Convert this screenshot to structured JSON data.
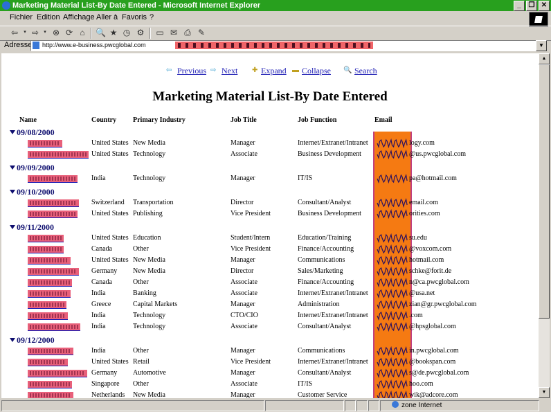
{
  "window": {
    "title": "Marketing Material List-By Date Entered - Microsoft Internet Explorer"
  },
  "menu": [
    {
      "label": "Fichier"
    },
    {
      "label": "Edition"
    },
    {
      "label": "Affichage"
    },
    {
      "label": "Aller à"
    },
    {
      "label": "Favoris"
    },
    {
      "label": "?"
    }
  ],
  "address": {
    "label": "Adresse",
    "url": "http://www.e-business.pwcglobal.com"
  },
  "nav": {
    "previous": "Previous",
    "next": "Next",
    "expand": "Expand",
    "collapse": "Collapse",
    "search": "Search"
  },
  "page": {
    "title": "Marketing Material List-By Date Entered"
  },
  "columns": {
    "name": "Name",
    "country": "Country",
    "industry": "Primary Industry",
    "title": "Job Title",
    "function": "Job Function",
    "email": "Email"
  },
  "groups": [
    {
      "date": "09/08/2000",
      "rows": [
        {
          "name_visible": "",
          "country": "United States",
          "industry": "New Media",
          "title": "Manager",
          "function": "Internet/Extranet/Intranet",
          "email_visible": "logy.com"
        },
        {
          "name_visible": "",
          "country": "United States",
          "industry": "Technology",
          "title": "Associate",
          "function": "Business Development",
          "email_visible": "@us.pwcglobal.com"
        }
      ]
    },
    {
      "date": "09/09/2000",
      "rows": [
        {
          "name_visible": "",
          "country": "India",
          "industry": "Technology",
          "title": "Manager",
          "function": "IT/IS",
          "email_visible": "pa@hotmail.com"
        }
      ]
    },
    {
      "date": "09/10/2000",
      "rows": [
        {
          "name_visible": "",
          "country": "Switzerland",
          "industry": "Transportation",
          "title": "Director",
          "function": "Consultant/Analyst",
          "email_visible": "email.com"
        },
        {
          "name_visible": "",
          "country": "United States",
          "industry": "Publishing",
          "title": "Vice President",
          "function": "Business Development",
          "email_visible": "orities.com"
        }
      ]
    },
    {
      "date": "09/11/2000",
      "rows": [
        {
          "name_visible": "",
          "country": "United States",
          "industry": "Education",
          "title": "Student/Intern",
          "function": "Education/Training",
          "email_visible": "su.edu"
        },
        {
          "name_visible": "",
          "country": "Canada",
          "industry": "Other",
          "title": "Vice President",
          "function": "Finance/Accounting",
          "email_visible": "@voxcom.com"
        },
        {
          "name_visible": "",
          "country": "United States",
          "industry": "New Media",
          "title": "Manager",
          "function": "Communications",
          "email_visible": "hotmail.com"
        },
        {
          "name_visible": "",
          "country": "Germany",
          "industry": "New Media",
          "title": "Director",
          "function": "Sales/Marketing",
          "email_visible": "schke@forit.de"
        },
        {
          "name_visible": "",
          "country": "Canada",
          "industry": "Other",
          "title": "Associate",
          "function": "Finance/Accounting",
          "email_visible": "n@ca.pwcglobal.com"
        },
        {
          "name_visible": "",
          "country": "India",
          "industry": "Banking",
          "title": "Associate",
          "function": "Internet/Extranet/Intranet",
          "email_visible": "@usa.net"
        },
        {
          "name_visible": "",
          "country": "Greece",
          "industry": "Capital Markets",
          "title": "Manager",
          "function": "Administration",
          "email_visible": "zian@gr.pwcglobal.com"
        },
        {
          "name_visible": "",
          "country": "India",
          "industry": "Technology",
          "title": "CTO/CIO",
          "function": "Internet/Extranet/Intranet",
          "email_visible": ".com"
        },
        {
          "name_visible": "",
          "country": "India",
          "industry": "Technology",
          "title": "Associate",
          "function": "Consultant/Analyst",
          "email_visible": "@hpsglobal.com"
        }
      ]
    },
    {
      "date": "09/12/2000",
      "rows": [
        {
          "name_visible": "",
          "country": "India",
          "industry": "Other",
          "title": "Manager",
          "function": "Communications",
          "email_visible": "in.pwcglobal.com"
        },
        {
          "name_visible": "",
          "country": "United States",
          "industry": "Retail",
          "title": "Vice President",
          "function": "Internet/Extranet/Intranet",
          "email_visible": "@bookspan.com"
        },
        {
          "name_visible": "",
          "country": "Germany",
          "industry": "Automotive",
          "title": "Manager",
          "function": "Consultant/Analyst",
          "email_visible": "s@de.pwcglobal.com"
        },
        {
          "name_visible": "",
          "country": "Singapore",
          "industry": "Other",
          "title": "Associate",
          "function": "IT/IS",
          "email_visible": "hoo.com"
        },
        {
          "name_visible": "",
          "country": "Netherlands",
          "industry": "New Media",
          "title": "Manager",
          "function": "Customer Service",
          "email_visible": "wik@adcore.com"
        }
      ]
    }
  ],
  "status": {
    "zone": "zone Internet"
  },
  "colors": {
    "titlebar": "#28a01e",
    "link": "#1c1cb4",
    "redact_pink": "#e8607a",
    "redact_orange": "#f57a12"
  }
}
